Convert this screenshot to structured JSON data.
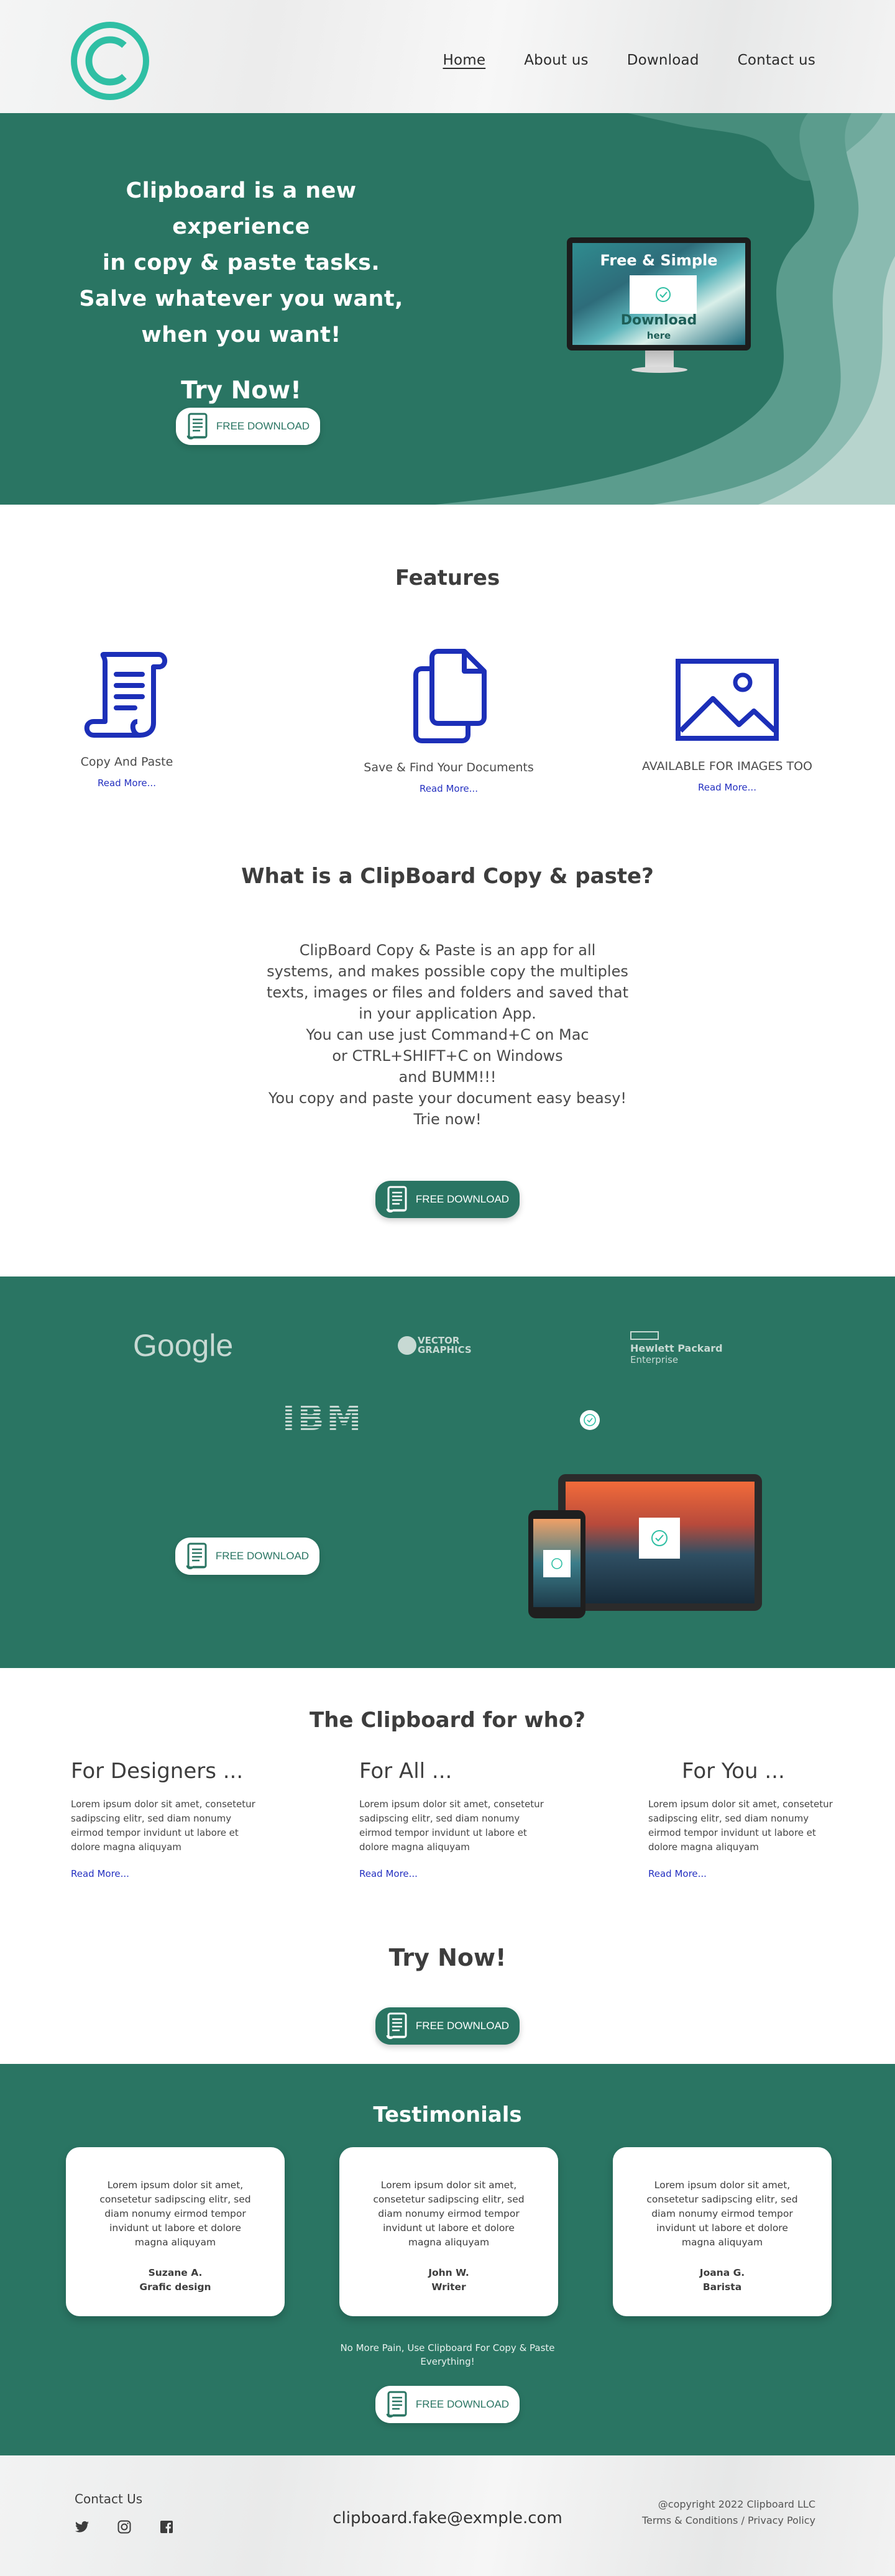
{
  "nav": {
    "items": [
      {
        "label": "Home",
        "active": true
      },
      {
        "label": "About us"
      },
      {
        "label": "Download"
      },
      {
        "label": "Contact us"
      }
    ]
  },
  "hero": {
    "title_lines": [
      "Clipboard is a new experience",
      "in copy & paste tasks.",
      "Salve whatever you want,",
      "when you want!"
    ],
    "try_now": "Try Now!",
    "button_label": "FREE DOWNLOAD",
    "monitor": {
      "title": "Free & Simple",
      "download": "Download",
      "here": "here"
    }
  },
  "features": {
    "title": "Features",
    "items": [
      {
        "label": "Copy And Paste",
        "more": "Read More...",
        "icon": "scroll-icon"
      },
      {
        "label": "Save & Find Your Documents",
        "more": "Read More...",
        "icon": "documents-icon"
      },
      {
        "label": "AVAILABLE FOR IMAGES TOO",
        "more": "Read More...",
        "icon": "image-icon"
      }
    ]
  },
  "what": {
    "title": "What is a ClipBoard Copy & paste?",
    "lines": [
      "ClipBoard Copy & Paste is an app for all",
      "systems, and makes possible copy the multiples",
      "texts, images or files and folders and saved that",
      "in your application App.",
      "You can use just Command+C on Mac",
      "or CTRL+SHIFT+C on Windows",
      "and BUMM!!!",
      "You copy and paste your document easy beasy!",
      "Trie now!"
    ],
    "button_label": "FREE DOWNLOAD"
  },
  "partners": {
    "google": "Google",
    "vector": "VECTOR",
    "vector_sub": "GRAPHICS",
    "hp": "Hewlett Packard",
    "hp_sub": "Enterprise",
    "ibm": "IBM",
    "button_label": "FREE DOWNLOAD"
  },
  "forwho": {
    "title": "The Clipboard for who?",
    "columns": [
      {
        "title": "For Designers ...",
        "text": "Lorem ipsum dolor sit amet, consetetur sadipscing elitr, sed diam nonumy eirmod tempor invidunt ut labore et dolore magna aliquyam",
        "more": "Read More..."
      },
      {
        "title": "For All ...",
        "text": "Lorem ipsum dolor sit amet, consetetur sadipscing elitr, sed diam nonumy eirmod tempor invidunt ut labore et dolore magna aliquyam",
        "more": "Read More..."
      },
      {
        "title": "For You ...",
        "text": "Lorem ipsum dolor sit amet, consetetur sadipscing elitr, sed diam nonumy eirmod tempor invidunt ut labore et dolore magna aliquyam",
        "more": "Read More..."
      }
    ],
    "try_now": "Try Now!",
    "button_label": "FREE DOWNLOAD"
  },
  "testimonials": {
    "title": "Testimonials",
    "cards": [
      {
        "text": "Lorem ipsum dolor sit amet, consetetur sadipscing elitr, sed diam nonumy eirmod tempor invidunt ut labore et dolore magna aliquyam",
        "name": "Suzane A.",
        "role": "Grafic design"
      },
      {
        "text": "Lorem ipsum dolor sit amet, consetetur sadipscing elitr, sed diam nonumy eirmod tempor invidunt ut labore et dolore magna aliquyam",
        "name": "John W.",
        "role": "Writer"
      },
      {
        "text": "Lorem ipsum dolor sit amet, consetetur sadipscing elitr, sed diam nonumy eirmod tempor invidunt ut labore et dolore magna aliquyam",
        "name": "Joana G.",
        "role": "Barista"
      }
    ],
    "note_line1": "No More Pain, Use Clipboard For Copy & Paste",
    "note_line2": "Everything!",
    "button_label": "FREE DOWNLOAD"
  },
  "footer": {
    "contact": "Contact Us",
    "social": [
      "twitter-icon",
      "instagram-icon",
      "facebook-icon"
    ],
    "email": "clipboard.fake@exmple.com",
    "copyright": "@copyright 2022  Clipboard LLC",
    "terms": "Terms & Conditions",
    "privacy": "Privacy Policy",
    "separator": " / "
  },
  "colors": {
    "brand_green": "#2a7563",
    "logo_teal": "#2fbfa4",
    "icon_blue": "#1c2fb8",
    "link_blue": "#2430c0"
  }
}
